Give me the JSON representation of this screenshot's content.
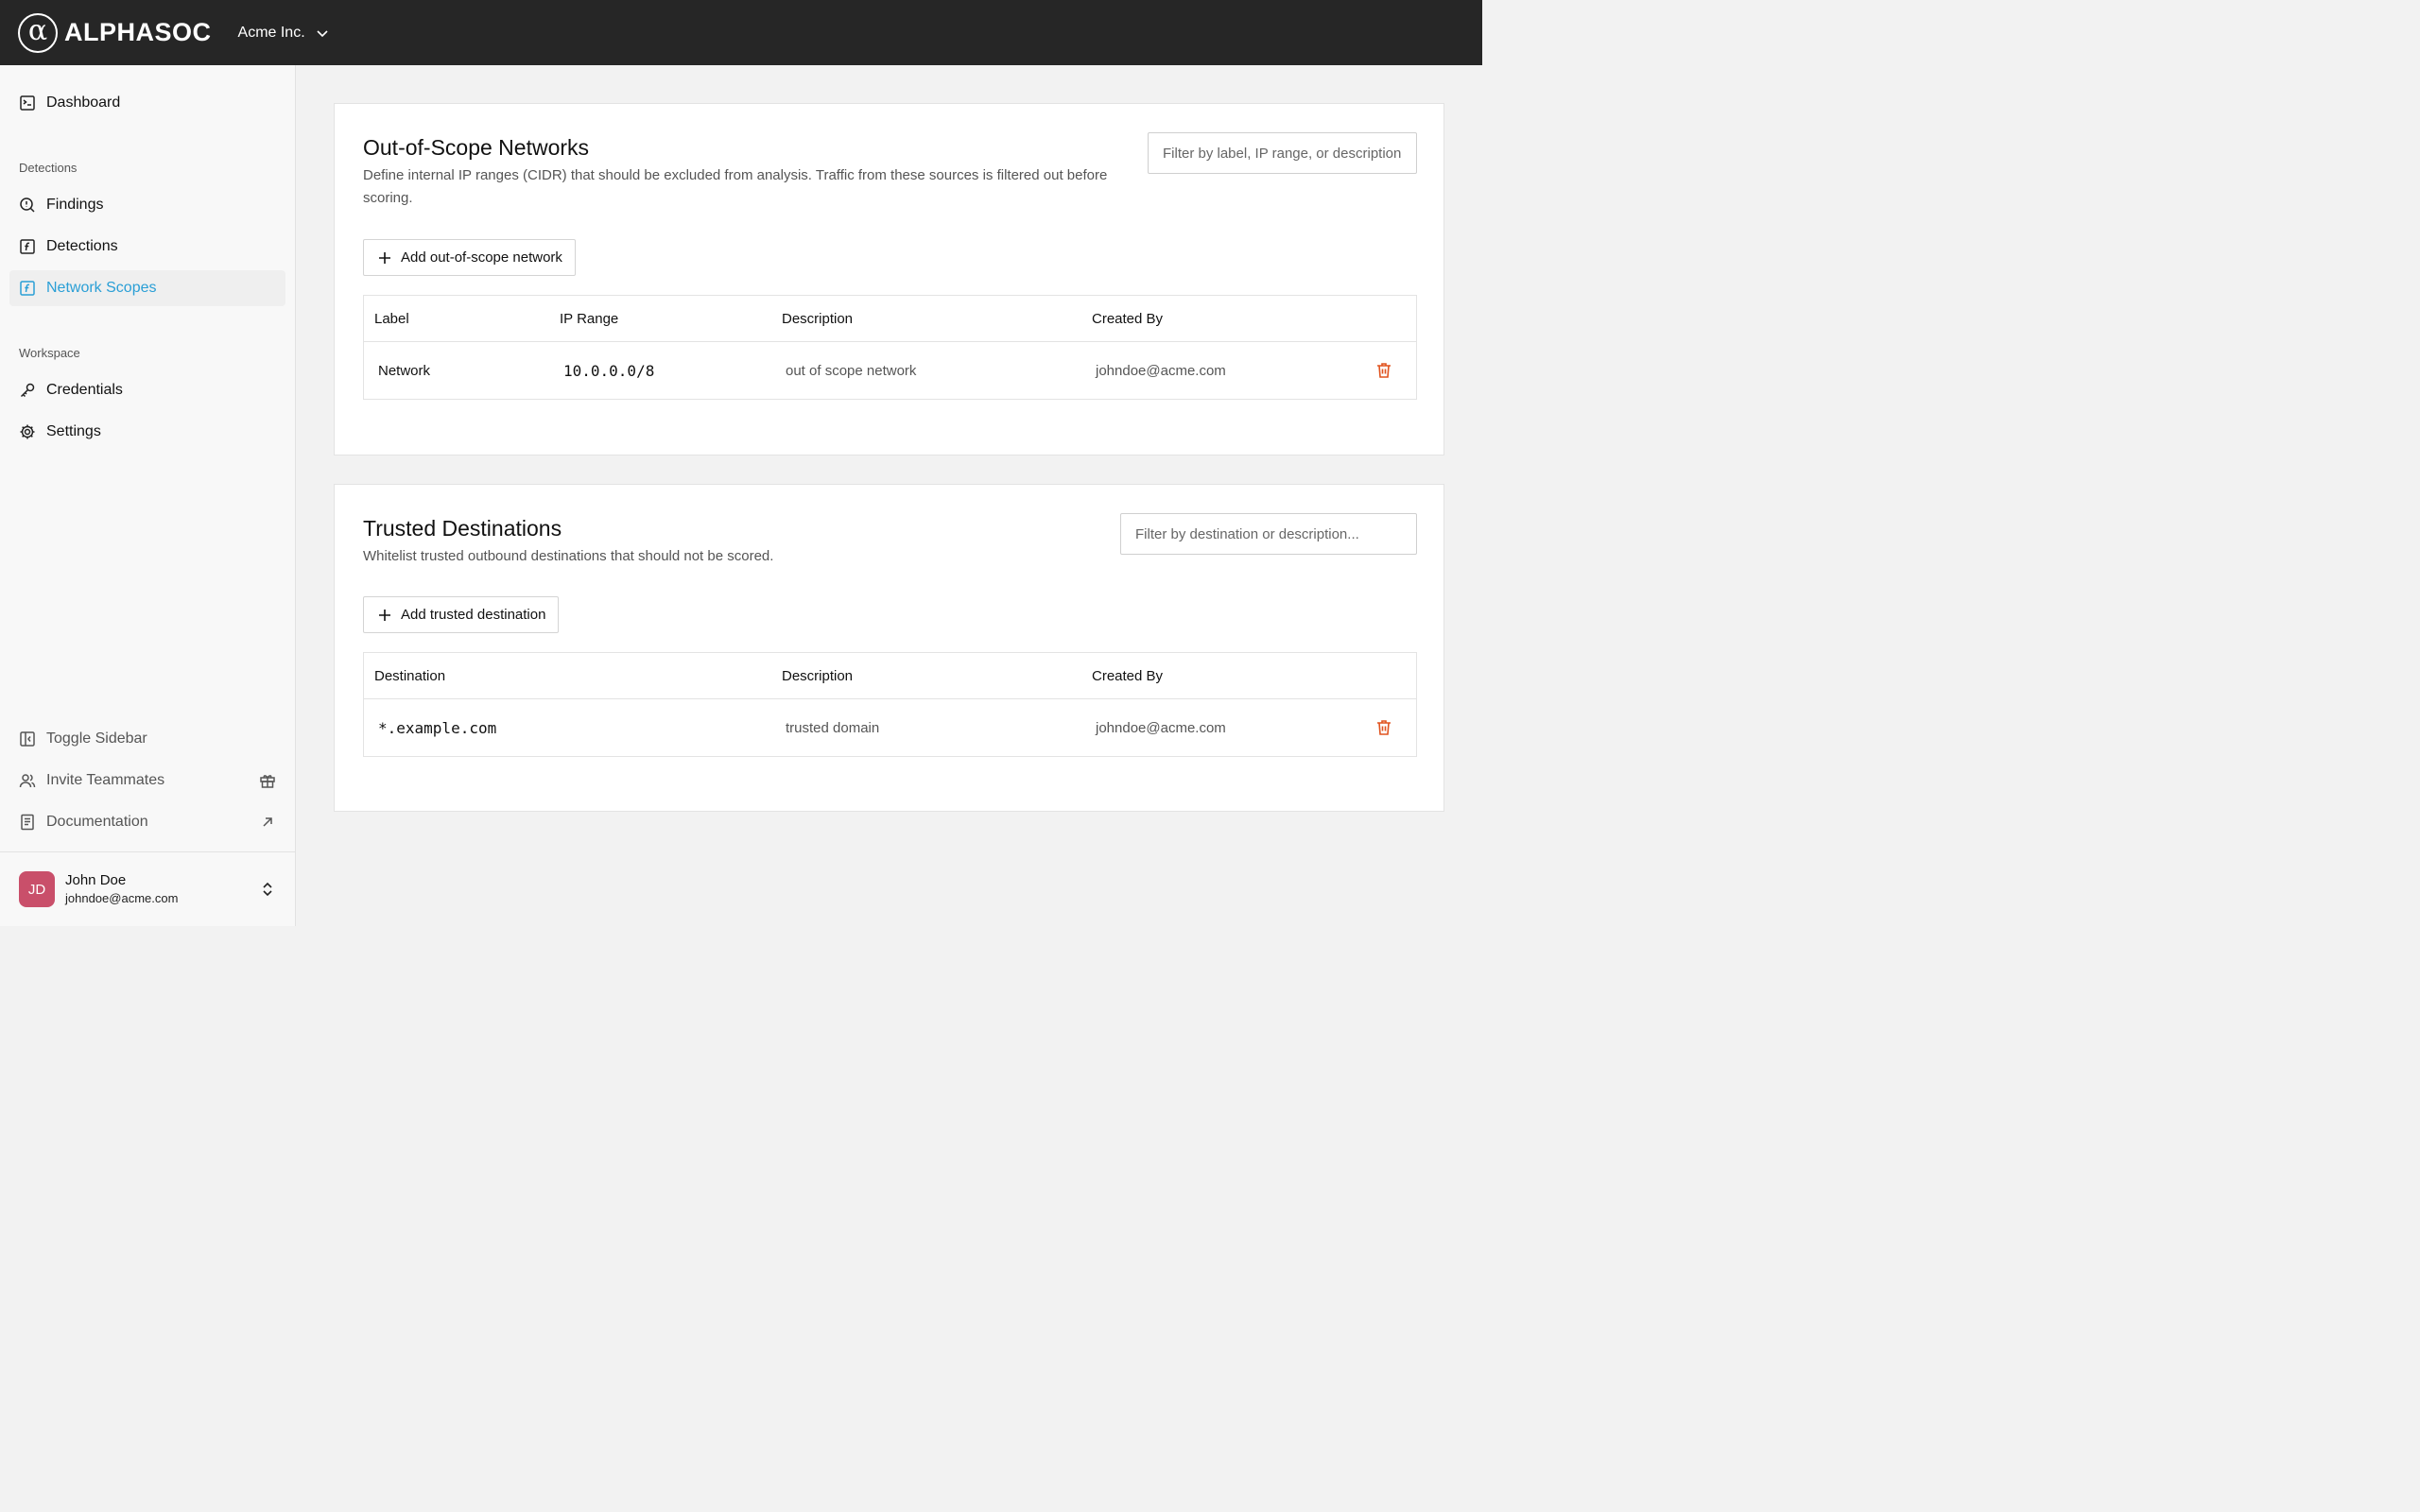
{
  "header": {
    "brand": "ALPHASOC",
    "org_name": "Acme Inc."
  },
  "sidebar": {
    "top_items": [
      {
        "label": "Dashboard",
        "icon": "dashboard-icon"
      }
    ],
    "sections": [
      {
        "label": "Detections",
        "items": [
          {
            "label": "Findings",
            "icon": "search-alert-icon"
          },
          {
            "label": "Detections",
            "icon": "function-icon"
          },
          {
            "label": "Network Scopes",
            "icon": "function-icon",
            "active": true
          }
        ]
      },
      {
        "label": "Workspace",
        "items": [
          {
            "label": "Credentials",
            "icon": "key-icon"
          },
          {
            "label": "Settings",
            "icon": "gear-icon"
          }
        ]
      }
    ],
    "bottom_items": [
      {
        "label": "Toggle Sidebar",
        "icon": "sidebar-toggle-icon"
      },
      {
        "label": "Invite Teammates",
        "icon": "users-icon",
        "trail_icon": "gift-icon"
      },
      {
        "label": "Documentation",
        "icon": "book-icon",
        "trail_icon": "external-arrow-icon"
      }
    ],
    "user": {
      "initials": "JD",
      "name": "John Doe",
      "email": "johndoe@acme.com"
    }
  },
  "out_of_scope": {
    "title": "Out-of-Scope Networks",
    "description": "Define internal IP ranges (CIDR) that should be excluded from analysis. Traffic from these sources is filtered out before scoring.",
    "filter_placeholder": "Filter by label, IP range, or description...",
    "add_label": "Add out-of-scope network",
    "columns": [
      "Label",
      "IP Range",
      "Description",
      "Created By"
    ],
    "rows": [
      {
        "label": "Network",
        "ip_range": "10.0.0.0/8",
        "description": "out of scope network",
        "created_by": "johndoe@acme.com"
      }
    ]
  },
  "trusted": {
    "title": "Trusted Destinations",
    "description": "Whitelist trusted outbound destinations that should not be scored.",
    "filter_placeholder": "Filter by destination or description...",
    "add_label": "Add trusted destination",
    "columns": [
      "Destination",
      "Description",
      "Created By"
    ],
    "rows": [
      {
        "destination": "*.example.com",
        "description": "trusted domain",
        "created_by": "johndoe@acme.com"
      }
    ]
  },
  "colors": {
    "topbar": "#262626",
    "accent": "#2a9fd6",
    "delete": "#e0531f",
    "avatar": "#c94f6a"
  }
}
